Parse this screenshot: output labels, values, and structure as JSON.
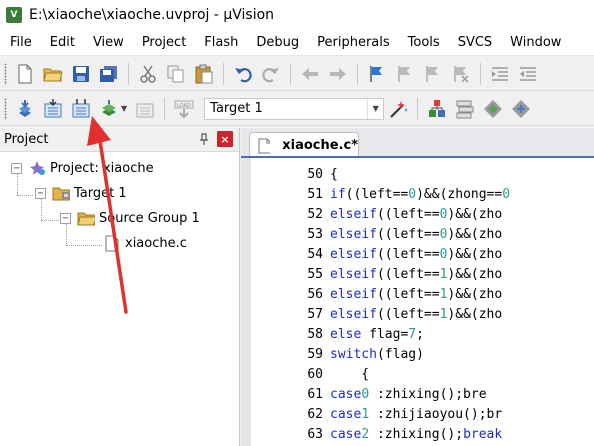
{
  "window": {
    "title": "E:\\xiaoche\\xiaoche.uvproj - µVision",
    "app_icon_letter": "V"
  },
  "menu": [
    "File",
    "Edit",
    "View",
    "Project",
    "Flash",
    "Debug",
    "Peripherals",
    "Tools",
    "SVCS",
    "Window"
  ],
  "toolbar2": {
    "target_value": "Target 1"
  },
  "project_panel": {
    "title": "Project",
    "pin_glyph": "ᵖ",
    "close_glyph": "×",
    "tree": {
      "root": "Project: xiaoche",
      "target": "Target 1",
      "group": "Source Group 1",
      "file": "xiaoche.c"
    }
  },
  "editor": {
    "tab_label": "xiaoche.c*",
    "lines": [
      {
        "n": "50",
        "code": "{"
      },
      {
        "n": "51",
        "code": "    if((left==0)&&(zhong==0"
      },
      {
        "n": "52",
        "code": "    else if((left==0)&&(zho"
      },
      {
        "n": "53",
        "code": "    else if((left==0)&&(zho"
      },
      {
        "n": "54",
        "code": "    else if((left==0)&&(zho"
      },
      {
        "n": "55",
        "code": "    else if((left==1)&&(zho"
      },
      {
        "n": "56",
        "code": "    else if((left==1)&&(zho"
      },
      {
        "n": "57",
        "code": "    else if((left==1)&&(zho"
      },
      {
        "n": "58",
        "code": "    else flag=7;"
      },
      {
        "n": "59",
        "code": "    switch(flag)"
      },
      {
        "n": "60",
        "code": "    {"
      },
      {
        "n": "61",
        "code": "      case 0 :zhixing();bre"
      },
      {
        "n": "62",
        "code": "    case 1 :zhijiaoyou();br"
      },
      {
        "n": "63",
        "code": "    case 2 :zhixing();break"
      }
    ]
  },
  "colors": {
    "keyword": "#1d2cbf",
    "number": "#2f9d8f",
    "annotation_arrow": "#e0312e",
    "tab_accent": "#4a6fb6"
  }
}
